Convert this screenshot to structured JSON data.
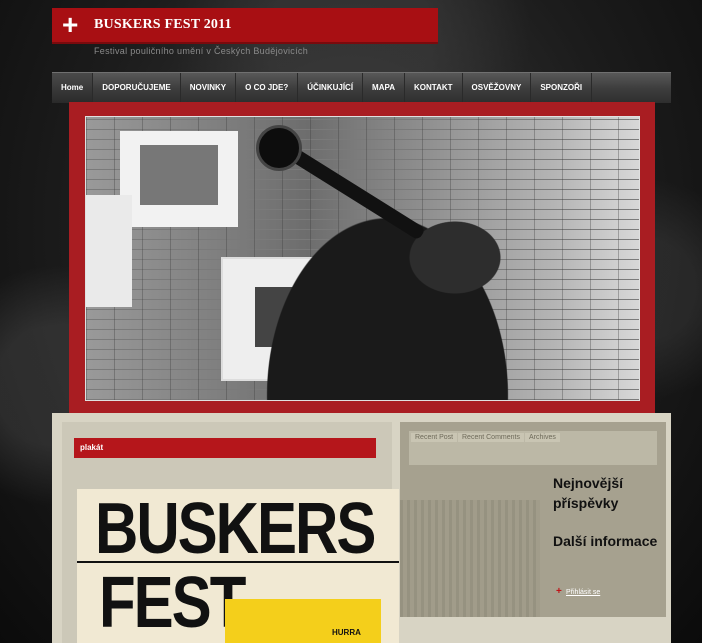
{
  "site": {
    "title": "BUSKERS FEST 2011",
    "tagline": "Festival pouličního umění v Českých Budějovicích",
    "logo_icon": "plus-icon"
  },
  "nav": {
    "items": [
      "Home",
      "DOPORUČUJEME",
      "NOVINKY",
      "O CO JDE?",
      "ÚČINKUJÍCÍ",
      "MAPA",
      "KONTAKT",
      "OSVĚŽOVNY",
      "SPONZOŘI"
    ],
    "active_index": 0
  },
  "main": {
    "widget_title": "plakát",
    "poster": {
      "line1": "BUSKERS",
      "line2": "FEST",
      "extra": "HURRA"
    }
  },
  "sidebar": {
    "tabs": [
      "Recent Post",
      "Recent Comments",
      "Archives"
    ],
    "headings": [
      "Nejnovější příspěvky",
      "Další informace"
    ],
    "login_label": "Přihlásit se"
  },
  "colors": {
    "accent_red": "#a80f13",
    "nav_bg": "#3e3e3e",
    "panel_bg": "#d8d4c4"
  }
}
